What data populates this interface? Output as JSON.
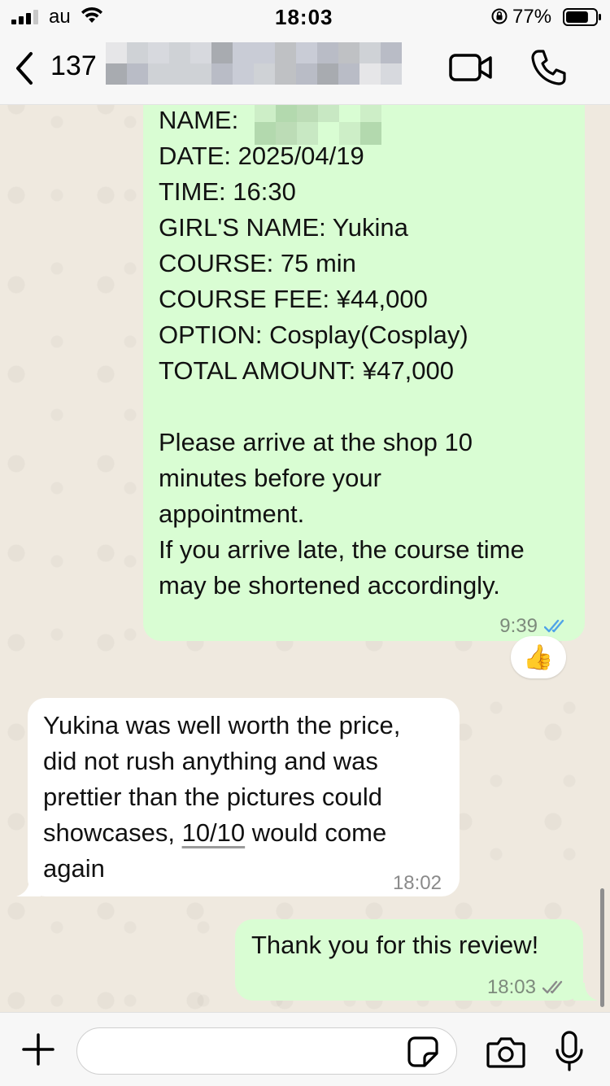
{
  "status_bar": {
    "carrier": "au",
    "time": "18:03",
    "battery_percent": "77%",
    "battery_level": 0.77
  },
  "header": {
    "back_count": "137"
  },
  "messages": [
    {
      "direction": "outgoing",
      "lines": [
        "NAME:",
        "DATE: 2025/04/19",
        "TIME: 16:30",
        "GIRL'S NAME: Yukina",
        "COURSE: 75 min",
        "COURSE FEE: ¥44,000",
        "OPTION: Cosplay(Cosplay)",
        "TOTAL AMOUNT: ¥47,000",
        "",
        "Please arrive at the shop 10",
        "minutes before your",
        "appointment.",
        "If you arrive late, the course time",
        "may be shortened accordingly."
      ],
      "time": "9:39",
      "status": "read",
      "reaction": "👍"
    },
    {
      "direction": "incoming",
      "lines": [
        "Yukina was well worth the price,",
        "did not rush anything and was",
        "prettier than the pictures could"
      ],
      "line4_before": "showcases, ",
      "line4_link": "10/10",
      "line4_after": " would come",
      "line5": "again",
      "time": "18:02"
    },
    {
      "direction": "outgoing",
      "lines": [
        "Thank you for this review!"
      ],
      "time": "18:03",
      "status": "delivered"
    }
  ],
  "colors": {
    "outgoing_bubble": "#d9fdd3",
    "incoming_bubble": "#ffffff",
    "read_tick": "#4fa3e8",
    "delivered_tick": "#8a8a8a"
  },
  "icons": {
    "back": "chevron-left-icon",
    "video": "video-camera-icon",
    "call": "phone-icon",
    "attach": "plus-icon",
    "sticker": "sticker-icon",
    "camera": "camera-icon",
    "mic": "microphone-icon"
  }
}
